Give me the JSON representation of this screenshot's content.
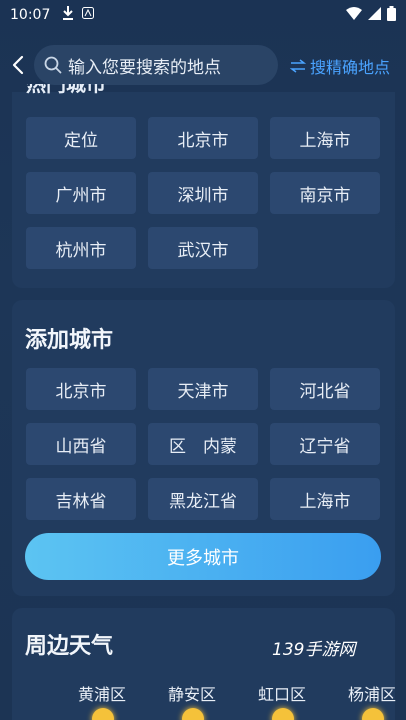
{
  "status_bar": {
    "time": "10:07",
    "left_icons": [
      "download-icon",
      "app-notification-icon"
    ],
    "right_icons": [
      "wifi-icon",
      "signal-icon",
      "battery-icon"
    ]
  },
  "search": {
    "placeholder": "输入您要搜索的地点",
    "precise_link": "搜精确地点",
    "precise_icon": "swap-arrows-icon"
  },
  "hot_cities": {
    "items": [
      "定位",
      "北京市",
      "上海市",
      "广州市",
      "深圳市",
      "南京市",
      "杭州市",
      "武汉市"
    ]
  },
  "add_city": {
    "title": "添加城市",
    "items": [
      "北京市",
      "天津市",
      "河北省",
      "山西省",
      "区　内蒙",
      "辽宁省",
      "吉林省",
      "黑龙江省",
      "上海市"
    ],
    "more_button": "更多城市"
  },
  "nearby_weather": {
    "title": "周边天气",
    "districts": [
      "黄浦区",
      "静安区",
      "虹口区",
      "杨浦区"
    ]
  },
  "watermark": "139手游网",
  "colors": {
    "background": "#1c3454",
    "card": "#213b5e",
    "button": "#2c4870",
    "accent": "#4aa3ff",
    "more_button_gradient": [
      "#5cc4f2",
      "#3a9ef0"
    ]
  }
}
